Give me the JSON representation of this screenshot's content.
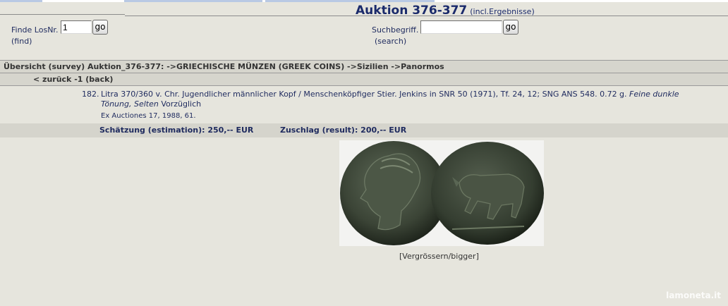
{
  "header": {
    "title": "Auktion 376-377",
    "subtitle": "(incl.Ergebnisse)"
  },
  "find": {
    "label": "Finde LosNr.",
    "sublabel": "(find)",
    "value": "1",
    "button": "go"
  },
  "search": {
    "label": "Suchbegriff.",
    "sublabel": "(search)",
    "value": "",
    "button": "go"
  },
  "breadcrumb": "Übersicht (survey) Auktion_376-377: ->GRIECHISCHE MÜNZEN (GREEK COINS) ->Sizilien ->Panormos",
  "back": "< zurück -1 (back)",
  "lot": {
    "number": "182.",
    "desc_main": "Litra 370/360 v. Chr. Jugendlicher männlicher Kopf / Menschenköpfiger Stier. Jenkins in SNR 50 (1971), Tf. 24, 12; SNG ANS 548. 0.72 g. ",
    "desc_italic": "Feine dunkle Tönung, Selten",
    "desc_grade": " Vorzüglich",
    "reference": "Ex Auctiones 17, 1988, 61."
  },
  "estimate": "Schätzung (estimation): 250,-- EUR",
  "result": "Zuschlag (result): 200,-- EUR",
  "image_caption": "[Vergrössern/bigger]",
  "watermark": "lamoneta.it"
}
